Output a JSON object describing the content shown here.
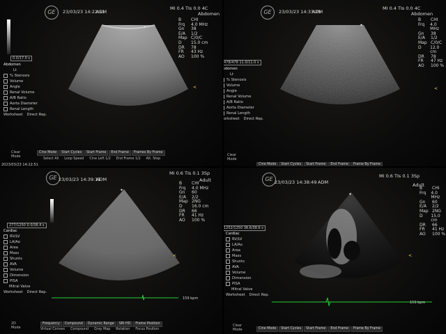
{
  "q1": {
    "header": {
      "datetime": "23/03/23 14:22:51",
      "user": "ADM",
      "mi": "MI 0.4",
      "tis": "TIs 0.0",
      "probe": "4C",
      "preset": "Abdomen"
    },
    "params": [
      [
        "B",
        "CHI"
      ],
      [
        "Frq",
        "4.0 MHz"
      ],
      [
        "Gn",
        "38"
      ],
      [
        "E/A",
        "1/2"
      ],
      [
        "Map",
        "C/0/C"
      ],
      [
        "D",
        "15.0 cm"
      ],
      [
        "DR",
        "78"
      ],
      [
        "FR",
        "43 Hz"
      ],
      [
        "AO",
        "100 %"
      ]
    ],
    "cursor_readout": "0.0/17.0 s",
    "measure": {
      "title": "Abdomen",
      "sub": "Lt",
      "items": [
        "% Stenosis",
        "Volume",
        "Angle",
        "Renal Volume",
        "A/B Ratio",
        "Aorta Diameter",
        "Renal Length"
      ],
      "footer": [
        "Worksheet",
        "Direct Rep."
      ]
    },
    "softkeys": [
      "Cine Mode",
      "Start Cycles",
      "Start Frame",
      "End Frame",
      "Frames By Frame"
    ],
    "subkeys": [
      "Select All",
      "Loop Speed",
      "Cine Left 1/2",
      "End Frame 1/2",
      "Alt. Step"
    ],
    "mode_text": "Clear\nMode",
    "timestamp": "2023/03/23 14:22:51"
  },
  "q2": {
    "header": {
      "datetime": "23/03/23 14:33:25",
      "user": "ADM",
      "mi": "MI 0.4",
      "tis": "TIs 0.0",
      "probe": "4C",
      "preset": "Abdomen"
    },
    "params": [
      [
        "B",
        "CHI"
      ],
      [
        "Frq",
        "4.0 MHz"
      ],
      [
        "Gn",
        "38"
      ],
      [
        "E/A",
        "1/2"
      ],
      [
        "Map",
        "C/0/C"
      ],
      [
        "D",
        "12.0 cm"
      ],
      [
        "DR",
        "78"
      ],
      [
        "FR",
        "47 Hz"
      ],
      [
        "AO",
        "100 %"
      ]
    ],
    "cursor_readout": "11.0/11.0 s",
    "cursor_frame": "478/478",
    "measure": {
      "title": "Abdomen",
      "sub": "Lt",
      "items": [
        "% Stenosis",
        "Volume",
        "Angle",
        "Renal Volume",
        "A/B Ratio",
        "Aorta Diameter",
        "Renal Length"
      ],
      "footer": [
        "Worksheet",
        "Direct Rep."
      ]
    },
    "softkeys": [
      "Cine Mode",
      "Start Cycles",
      "Start Frame",
      "End Frame",
      "Frame By Frame"
    ],
    "mode_text": "Clear\nMode"
  },
  "q3": {
    "header": {
      "datetime": "23/03/23 14:39:11",
      "user": "ADM",
      "mi": "MI 0.6",
      "tis": "TIs 0.1",
      "probe": "3Sp",
      "preset": "Adult"
    },
    "params": [
      [
        "B",
        "CHI"
      ],
      [
        "Frq",
        "4.0 MHz"
      ],
      [
        "Gn",
        "60"
      ],
      [
        "E/A",
        "2/2"
      ],
      [
        "Map",
        "2NG"
      ],
      [
        "D",
        "16.0 cm"
      ],
      [
        "DR",
        "66"
      ],
      [
        "FR",
        "41 Hz"
      ],
      [
        "AO",
        "100 %"
      ]
    ],
    "cursor_readout": "0.0/38.4 s",
    "cursor_frame": "277/1250",
    "measure": {
      "title": "Cardiac",
      "items": [
        "RV/LV",
        "LA/Ao",
        "Area",
        "Mass",
        "Shunts",
        "AVA",
        "Volume",
        "Dimension",
        "PISA"
      ],
      "extra": "Mitral Valve",
      "footer": [
        "Worksheet",
        "Direct Rep."
      ]
    },
    "softkeys": [
      "Frequency",
      "Compound",
      "Dynamic Range",
      "SRI HD",
      "Frame Position"
    ],
    "subkeys": [
      "Virtual Convex",
      "Compound",
      "Gray Map",
      "Rotation",
      "Focus Position"
    ],
    "hr": "159 bpm",
    "mode_text": "2D\nMode"
  },
  "q4": {
    "header": {
      "datetime": "23/03/23 14:38:49",
      "user": "ADM",
      "mi": "MI 0.6",
      "tis": "TIs 0.1",
      "probe": "3Sp",
      "preset": "Adult"
    },
    "params": [
      [
        "B",
        "CHI"
      ],
      [
        "Frq",
        "4.0 MHz"
      ],
      [
        "Gn",
        "60"
      ],
      [
        "E/A",
        "2/2"
      ],
      [
        "Map",
        "2NG"
      ],
      [
        "D",
        "15.0 cm"
      ],
      [
        "DR",
        "66"
      ],
      [
        "FR",
        "41 Hz"
      ],
      [
        "AO",
        "100 %"
      ]
    ],
    "cursor_readout": "38.6/38.6 s",
    "cursor_frame": "1252/1250",
    "measure": {
      "title": "Cardiac",
      "items": [
        "RV/LV",
        "LA/Ao",
        "Area",
        "Mass",
        "Shunts",
        "AVA",
        "Volume",
        "Dimension",
        "PISA"
      ],
      "extra": "Mitral Valve",
      "footer": [
        "Worksheet",
        "Direct Rep."
      ]
    },
    "softkeys": [
      "Cine Mode",
      "Start Cycles",
      "Start Frame",
      "End Frame",
      "Frame By Frame"
    ],
    "hr": "159 bpm",
    "mode_text": "Clear\nMode"
  },
  "logo_text": "GE"
}
